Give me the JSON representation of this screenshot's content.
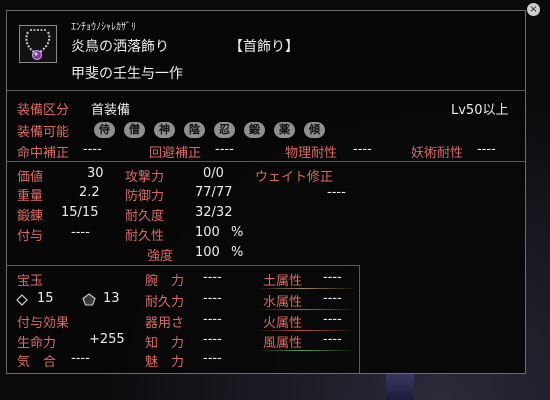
{
  "item": {
    "furigana": "ｴﾝﾁｮｳﾉｼｬﾚｶｻﾞﾘ",
    "name": "炎鳥の洒落飾り",
    "slot_tag": "【首飾り】",
    "maker": "甲斐の壬生与一作",
    "icon": "necklace-icon"
  },
  "equip": {
    "class_label": "装備区分",
    "class_value": "首装備",
    "level_req": "Lv50以上",
    "usable_label": "装備可能",
    "usable_jobs": [
      "侍",
      "僧",
      "神",
      "陰",
      "忍",
      "鍛",
      "薬",
      "傾"
    ]
  },
  "bonus": {
    "hit_label": "命中補正",
    "hit_value": "----",
    "evade_label": "回避補正",
    "evade_value": "----",
    "phys_label": "物理耐性",
    "phys_value": "----",
    "magic_label": "妖術耐性",
    "magic_value": "----"
  },
  "stats": {
    "price_label": "価値",
    "price_value": "30",
    "weight_label": "重量",
    "weight_value": "2.2",
    "forge_label": "鍛錬",
    "forge_value": "15/15",
    "enchant_label": "付与",
    "enchant_value": "----",
    "attack_label": "攻撃力",
    "attack_value": "0/0",
    "defense_label": "防御力",
    "defense_value": "77/77",
    "durability_label": "耐久度",
    "durability_value": "32/32",
    "endure_label": "耐久性",
    "endure_value": "100",
    "strength_label": "強度",
    "strength_value": "100",
    "percent": "%",
    "weight_fix_label": "ウェイト修正",
    "weight_fix_value": "----"
  },
  "gems": {
    "label": "宝玉",
    "diamond_count": "15",
    "pentagon_count": "13",
    "effect_label": "付与効果",
    "life_label": "生命力",
    "life_value": "+255",
    "ki_label": "気　合",
    "ki_value": "----"
  },
  "attributes": [
    {
      "label": "腕　力",
      "value": "----"
    },
    {
      "label": "耐久力",
      "value": "----"
    },
    {
      "label": "器用さ",
      "value": "----"
    },
    {
      "label": "知　力",
      "value": "----"
    },
    {
      "label": "魅　力",
      "value": "----"
    }
  ],
  "elements": [
    {
      "label": "土属性",
      "value": "----"
    },
    {
      "label": "水属性",
      "value": "----"
    },
    {
      "label": "火属性",
      "value": "----"
    },
    {
      "label": "風属性",
      "value": "----"
    }
  ],
  "colors": {
    "label_red": "#d86a64",
    "earth": "#a08a5a",
    "water": "#5a7ab0",
    "fire": "#c0503a",
    "wind": "#5aa060"
  }
}
